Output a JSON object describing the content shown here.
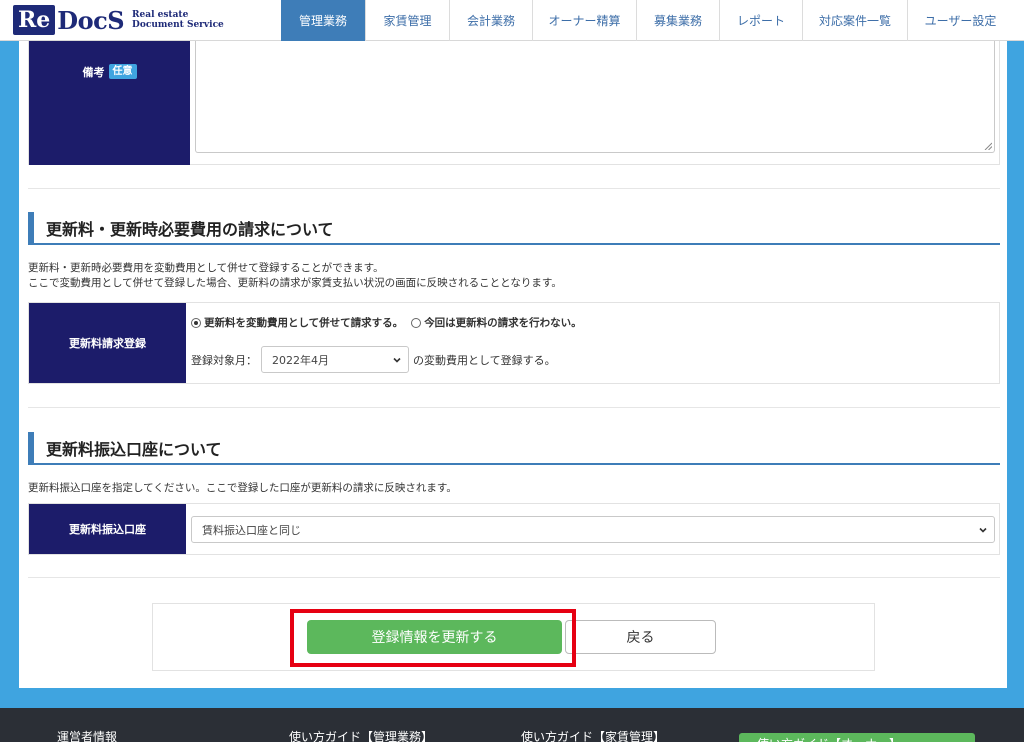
{
  "header": {
    "logo_mark": "Re",
    "logo_word": "DocS",
    "logo_tag_line1": "Real estate",
    "logo_tag_line2": "Document Service",
    "nav": [
      {
        "label": "管理業務",
        "active": true
      },
      {
        "label": "家賃管理",
        "active": false
      },
      {
        "label": "会計業務",
        "active": false
      },
      {
        "label": "オーナー精算",
        "active": false
      },
      {
        "label": "募集業務",
        "active": false
      },
      {
        "label": "レポート",
        "active": false
      },
      {
        "label": "対応案件一覧",
        "active": false
      },
      {
        "label": "ユーザー設定",
        "active": false
      }
    ]
  },
  "note": {
    "label": "備考",
    "badge": "任意"
  },
  "renewal_fee": {
    "title": "更新料・更新時必要費用の請求について",
    "desc_line1": "更新料・更新時必要費用を変動費用として併せて登録することができます。",
    "desc_line2": "ここで変動費用として併せて登録した場合、更新料の請求が家賃支払い状況の画面に反映されることとなります。",
    "row_label": "更新料請求登録",
    "option_charge": "更新料を変動費用として併せて請求する。",
    "option_no_charge": "今回は更新料の請求を行わない。",
    "selected_option": "option_charge",
    "month_label": "登録対象月：",
    "month_value": "2022年4月",
    "month_suffix": "の変動費用として登録する。"
  },
  "renewal_account": {
    "title": "更新料振込口座について",
    "desc": "更新料振込口座を指定してください。ここで登録した口座が更新料の請求に反映されます。",
    "row_label": "更新料振込口座",
    "select_value": "賃料振込口座と同じ"
  },
  "actions": {
    "update_label": "登録情報を更新する",
    "back_label": "戻る"
  },
  "footer": {
    "links": [
      "運営者情報",
      "使い方ガイド【管理業務】",
      "使い方ガイド【家賃管理】"
    ],
    "guide_button": "使い方ガイド【オーナー】"
  },
  "colors": {
    "accent_blue": "#3e7db8",
    "label_navy": "#1c1c6a",
    "update_green": "#5cb85c",
    "highlight_red": "#e60012",
    "page_bg": "#3fa4e0"
  }
}
